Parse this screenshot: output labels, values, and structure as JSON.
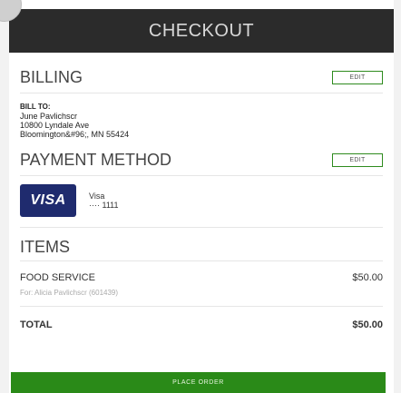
{
  "header": {
    "title": "CHECKOUT"
  },
  "billing": {
    "title": "BILLING",
    "edit_label": "EDIT",
    "bill_to_label": "BILL TO:",
    "name": "June Pavlichscr",
    "address_line1": "10800 Lyndale Ave",
    "address_line2": "Bloomington&#96;, MN 55424"
  },
  "payment": {
    "title": "PAYMENT METHOD",
    "edit_label": "EDIT",
    "card_brand": "VISA",
    "card_name": "Visa",
    "card_mask": "···· 1111"
  },
  "items": {
    "title": "ITEMS",
    "list": [
      {
        "name": "FOOD SERVICE",
        "price": "$50.00",
        "sub": "For: Alicia Pavlichscr (601439)"
      }
    ],
    "total_label": "TOTAL",
    "total_value": "$50.00"
  },
  "actions": {
    "place_order_label": "PLACE ORDER"
  },
  "colors": {
    "header_bg": "#2b2b2b",
    "accent_green": "#2a8a18",
    "visa_blue": "#1f2b6e"
  }
}
